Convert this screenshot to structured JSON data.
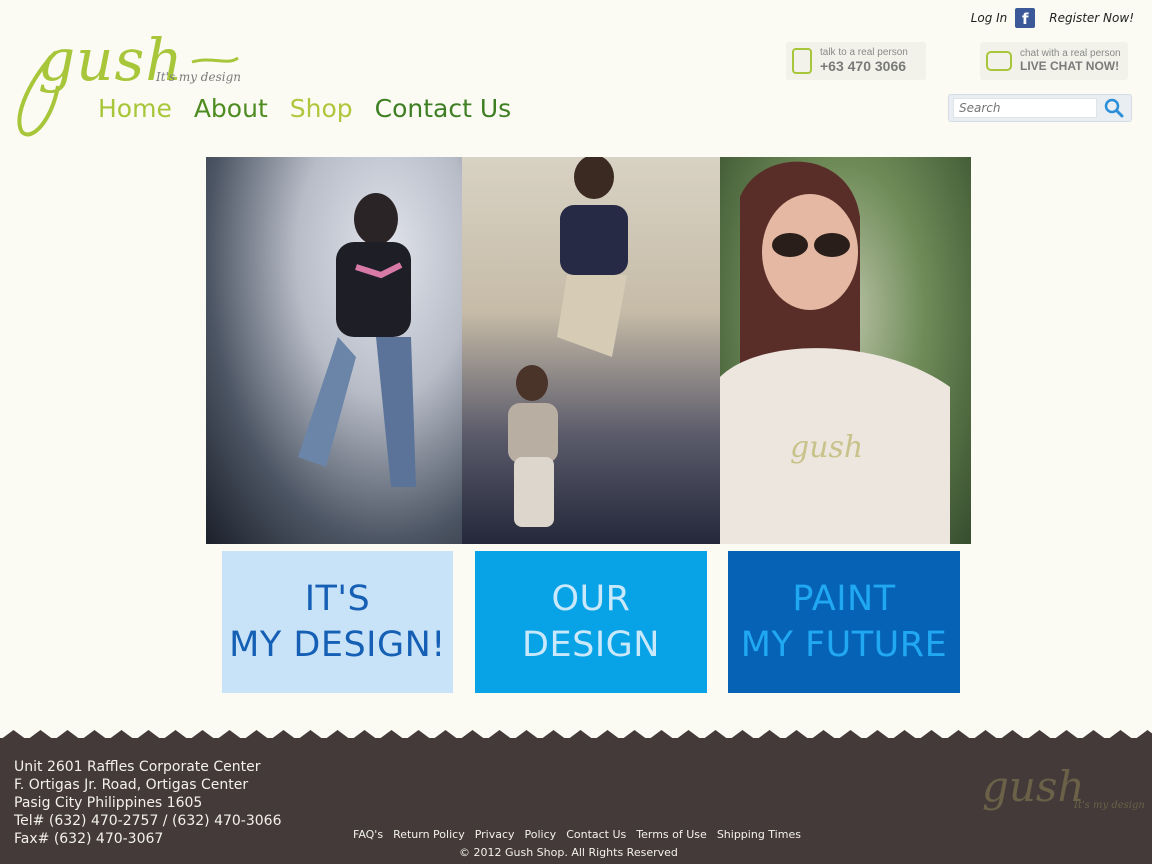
{
  "header": {
    "logo_text": "gush",
    "logo_tagline": "It's my design",
    "login_label": "Log In",
    "register_label": "Register Now!",
    "phone_small": "talk to a real person",
    "phone_number": "+63 470 3066",
    "chat_small": "chat with a real person",
    "chat_big": "LIVE CHAT NOW!",
    "search_placeholder": "Search"
  },
  "nav": {
    "home": "Home",
    "about": "About",
    "shop": "Shop",
    "contact": "Contact Us"
  },
  "tiles": [
    {
      "line1": "IT'S",
      "line2": "MY DESIGN!"
    },
    {
      "line1": "OUR",
      "line2": "DESIGN"
    },
    {
      "line1": "PAINT",
      "line2": "MY FUTURE"
    }
  ],
  "footer": {
    "address_lines": [
      "Unit 2601 Raffles Corporate Center",
      "F. Ortigas Jr. Road, Ortigas Center",
      "Pasig City Philippines 1605",
      "Tel# (632) 470-2757 / (632) 470-3066",
      "Fax# (632) 470-3067"
    ],
    "links": [
      "FAQ's",
      "Return Policy",
      "Privacy",
      "Policy",
      "Contact Us",
      "Terms of Use",
      "Shipping Times"
    ],
    "copyright": "© 2012 Gush Shop. All Rights Reserved",
    "logo_text": "gush",
    "logo_tagline": "It's my design"
  },
  "colors": {
    "background": "#fbfbf4",
    "brand_green": "#a8c63a",
    "nav_dark_green": "#4e8b21",
    "footer_bg": "#433a39",
    "tile1": "#c8e2f8",
    "tile2": "#08a2e6",
    "tile3": "#0562b5"
  }
}
